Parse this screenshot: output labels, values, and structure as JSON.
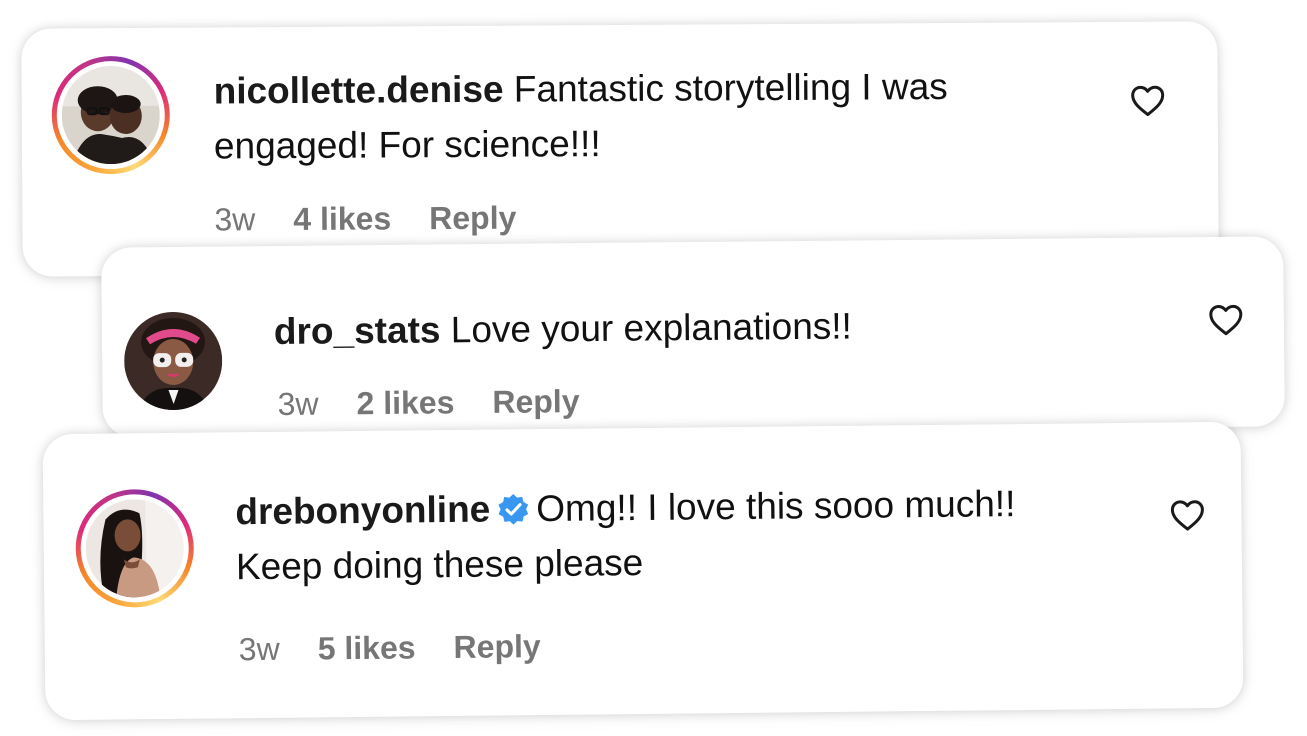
{
  "comments": [
    {
      "username": "nicollette.denise",
      "text": "Fantastic storytelling I was engaged! For science!!!",
      "time": "3w",
      "likes": "4 likes",
      "reply_label": "Reply",
      "verified": false,
      "story_ring": true,
      "avatar": "avatar-nicollette-denise"
    },
    {
      "username": "dro_stats",
      "text": "Love your explanations!!",
      "time": "3w",
      "likes": "2 likes",
      "reply_label": "Reply",
      "verified": false,
      "story_ring": false,
      "avatar": "avatar-dro-stats"
    },
    {
      "username": "drebonyonline",
      "text": "Omg!! I love this sooo much!! Keep doing these please",
      "time": "3w",
      "likes": "5 likes",
      "reply_label": "Reply",
      "verified": true,
      "story_ring": true,
      "avatar": "avatar-drebonyonline"
    }
  ],
  "icons": {
    "like": "heart-outline-icon",
    "verified": "verified-badge-icon"
  },
  "colors": {
    "verified_blue": "#3897f0",
    "meta_gray": "#767676",
    "story_ring_start": "#f58529",
    "story_ring_end": "#c13584"
  }
}
